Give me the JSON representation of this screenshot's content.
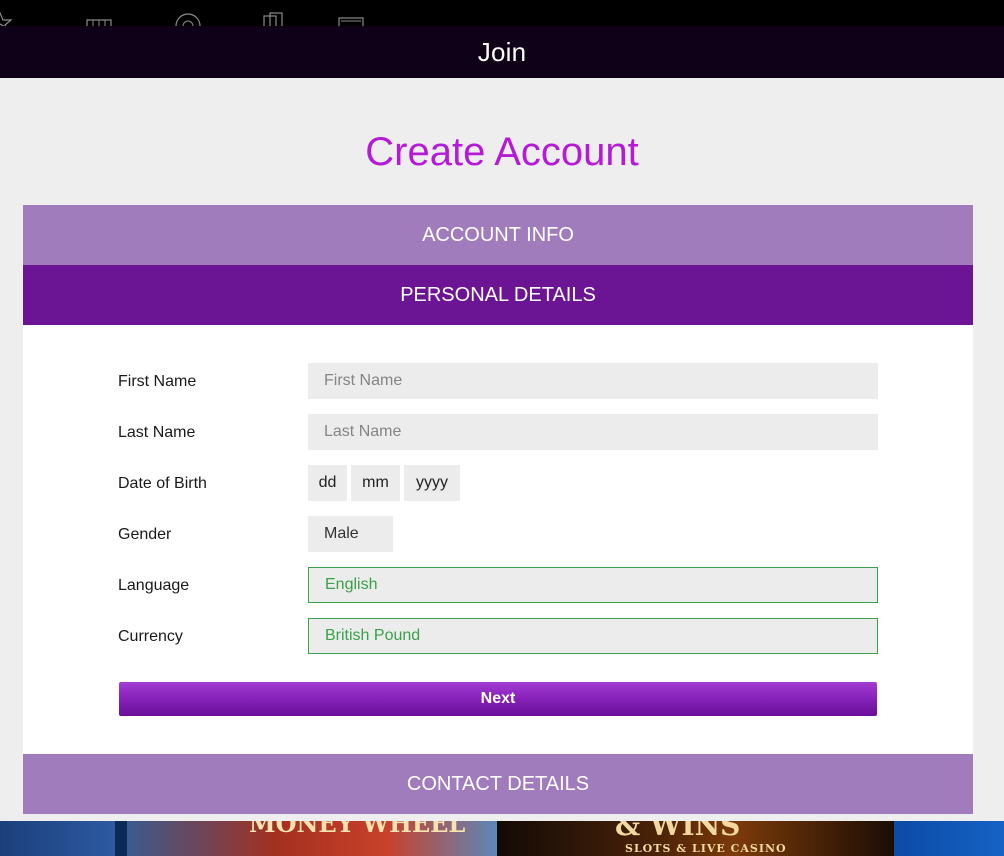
{
  "header": {
    "title": "Join"
  },
  "page": {
    "title": "Create Account"
  },
  "sections": {
    "account_info": "ACCOUNT INFO",
    "personal_details": "PERSONAL DETAILS",
    "contact_details": "CONTACT DETAILS"
  },
  "form": {
    "first_name": {
      "label": "First Name",
      "placeholder": "First Name"
    },
    "last_name": {
      "label": "Last Name",
      "placeholder": "Last Name"
    },
    "dob": {
      "label": "Date of Birth",
      "day": "dd",
      "month": "mm",
      "year": "yyyy"
    },
    "gender": {
      "label": "Gender",
      "value": "Male"
    },
    "language": {
      "label": "Language",
      "value": "English"
    },
    "currency": {
      "label": "Currency",
      "value": "British Pound"
    },
    "next_label": "Next"
  },
  "banner": {
    "tile2_text": "MONEY WHEEL",
    "tile3_text": "& WINS",
    "tile3_sub": "SLOTS & LIVE CASINO"
  },
  "colors": {
    "title": "#b51ad6",
    "section_light": "#a07cbc",
    "section_dark": "#6b1595",
    "valid_green": "#3aa04a"
  }
}
